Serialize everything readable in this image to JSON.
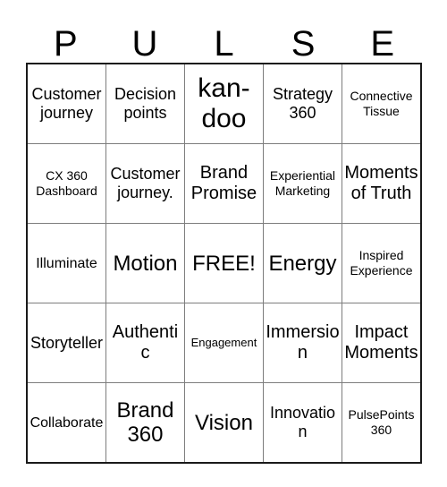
{
  "card": {
    "title_letters": [
      "P",
      "U",
      "L",
      "S",
      "E"
    ],
    "free_space_text": "FREE!",
    "grid": [
      [
        {
          "text": "Customer journey",
          "size": "fs-lg"
        },
        {
          "text": "Decision points",
          "size": "fs-lg"
        },
        {
          "text": "kan-doo",
          "size": "fs-huge"
        },
        {
          "text": "Strategy 360",
          "size": "fs-lg"
        },
        {
          "text": "Connective Tissue",
          "size": "fs-sm"
        }
      ],
      [
        {
          "text": "CX 360 Dashboard",
          "size": "fs-sm"
        },
        {
          "text": "Customer journey.",
          "size": "fs-lg"
        },
        {
          "text": "Brand Promise",
          "size": "fs-xl"
        },
        {
          "text": "Experiential Marketing",
          "size": "fs-sm"
        },
        {
          "text": "Moments of Truth",
          "size": "fs-xl"
        }
      ],
      [
        {
          "text": "Illuminate",
          "size": "fs-md"
        },
        {
          "text": "Motion",
          "size": "fs-xxl"
        },
        {
          "text": "FREE!",
          "size": "fs-xxl"
        },
        {
          "text": "Energy",
          "size": "fs-xxl"
        },
        {
          "text": "Inspired Experience",
          "size": "fs-sm"
        }
      ],
      [
        {
          "text": "Storyteller",
          "size": "fs-lg"
        },
        {
          "text": "Authentic",
          "size": "fs-xl"
        },
        {
          "text": "Engagement",
          "size": "fs-xs"
        },
        {
          "text": "Immersion",
          "size": "fs-xl"
        },
        {
          "text": "Impact Moments",
          "size": "fs-xl"
        }
      ],
      [
        {
          "text": "Collaborate",
          "size": "fs-md"
        },
        {
          "text": "Brand 360",
          "size": "fs-xxl"
        },
        {
          "text": "Vision",
          "size": "fs-xxl"
        },
        {
          "text": "Innovation",
          "size": "fs-lg"
        },
        {
          "text": "PulsePoints 360",
          "size": "fs-sm"
        }
      ]
    ]
  },
  "colors": {
    "outer_border": "#1a1a1a",
    "inner_border": "#7d7d7d",
    "text": "#000000",
    "background": "#ffffff"
  }
}
